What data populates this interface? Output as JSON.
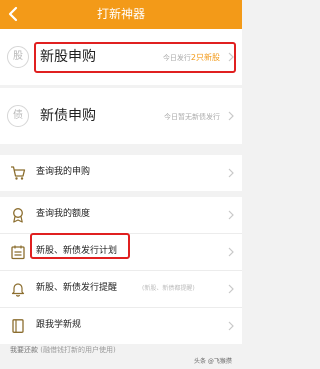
{
  "header": {
    "title": "打新神器",
    "background": "#f39a18"
  },
  "subscriptions": {
    "stock": {
      "icon_text": "股",
      "label": "新股申购",
      "hint_prefix": "今日发行",
      "hint_count": "2只新股"
    },
    "bond": {
      "icon_text": "债",
      "label": "新债申购",
      "hint": "今日暂无新债发行"
    }
  },
  "menu": {
    "my_subscriptions": "查询我的申购",
    "my_quota": "查询我的额度",
    "issue_plan": "新股、新债发行计划",
    "issue_reminder": "新股、新债发行提醒",
    "issue_reminder_note": "(新股、新债都提醒)",
    "learn_rules": "跟我学新规"
  },
  "footer": {
    "text_strong": "我要还款",
    "text_note": "(融借钱打新的用户使用)"
  },
  "watermark": "头条 @飞猴攒",
  "colors": {
    "accent": "#f39a18",
    "highlight_box": "#e02020"
  },
  "icons": {
    "back": "chevron-left-icon",
    "cart": "cart-icon",
    "medal": "medal-icon",
    "calendar": "calendar-icon",
    "bell": "bell-icon",
    "book": "book-icon"
  }
}
